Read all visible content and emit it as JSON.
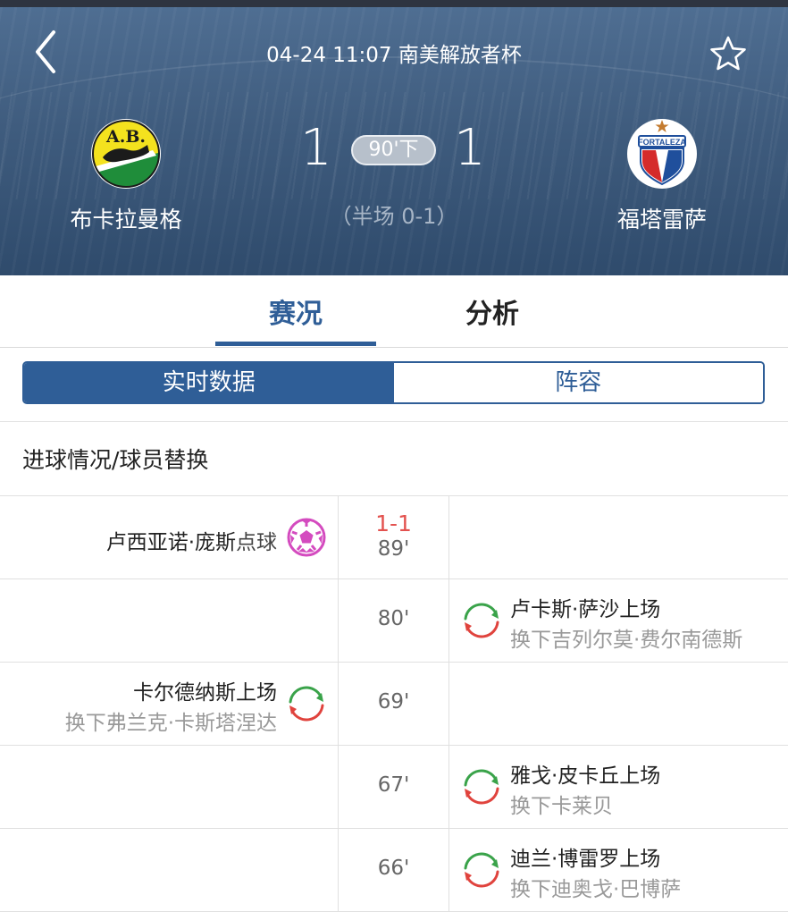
{
  "header": {
    "match_info": "04-24 11:07 南美解放者杯",
    "home": {
      "name": "布卡拉曼格",
      "score": "1",
      "logo_text": "A.B."
    },
    "away": {
      "name": "福塔雷萨",
      "score": "1",
      "logo_text": "FORTALEZA"
    },
    "minute": "90'下",
    "halftime": "（半场 0-1）"
  },
  "tabs": [
    {
      "label": "赛况",
      "active": true
    },
    {
      "label": "分析",
      "active": false
    }
  ],
  "segments": [
    {
      "label": "实时数据",
      "active": true
    },
    {
      "label": "阵容",
      "active": false
    }
  ],
  "section_title": "进球情况/球员替换",
  "events": [
    {
      "side": "home",
      "type": "goal",
      "minute": "89'",
      "score": "1-1",
      "player": "卢西亚诺·庞斯",
      "suffix": "点球",
      "icon": "soccer-ball-icon"
    },
    {
      "side": "away",
      "type": "sub",
      "minute": "80'",
      "in": "卢卡斯·萨沙上场",
      "out": "换下吉列尔莫·费尔南德斯",
      "icon": "substitution-icon"
    },
    {
      "side": "home",
      "type": "sub",
      "minute": "69'",
      "in": "卡尔德纳斯上场",
      "out": "换下弗兰克·卡斯塔涅达",
      "icon": "substitution-icon"
    },
    {
      "side": "away",
      "type": "sub",
      "minute": "67'",
      "in": "雅戈·皮卡丘上场",
      "out": "换下卡莱贝",
      "icon": "substitution-icon"
    },
    {
      "side": "away",
      "type": "sub",
      "minute": "66'",
      "in": "迪兰·博雷罗上场",
      "out": "换下迪奥戈·巴博萨",
      "icon": "substitution-icon"
    }
  ],
  "colors": {
    "accent": "#2f5e97",
    "goal_score": "#e3524f",
    "goal_icon": "#d44bbf",
    "sub_in": "#3aa34a",
    "sub_out": "#e0433d"
  }
}
